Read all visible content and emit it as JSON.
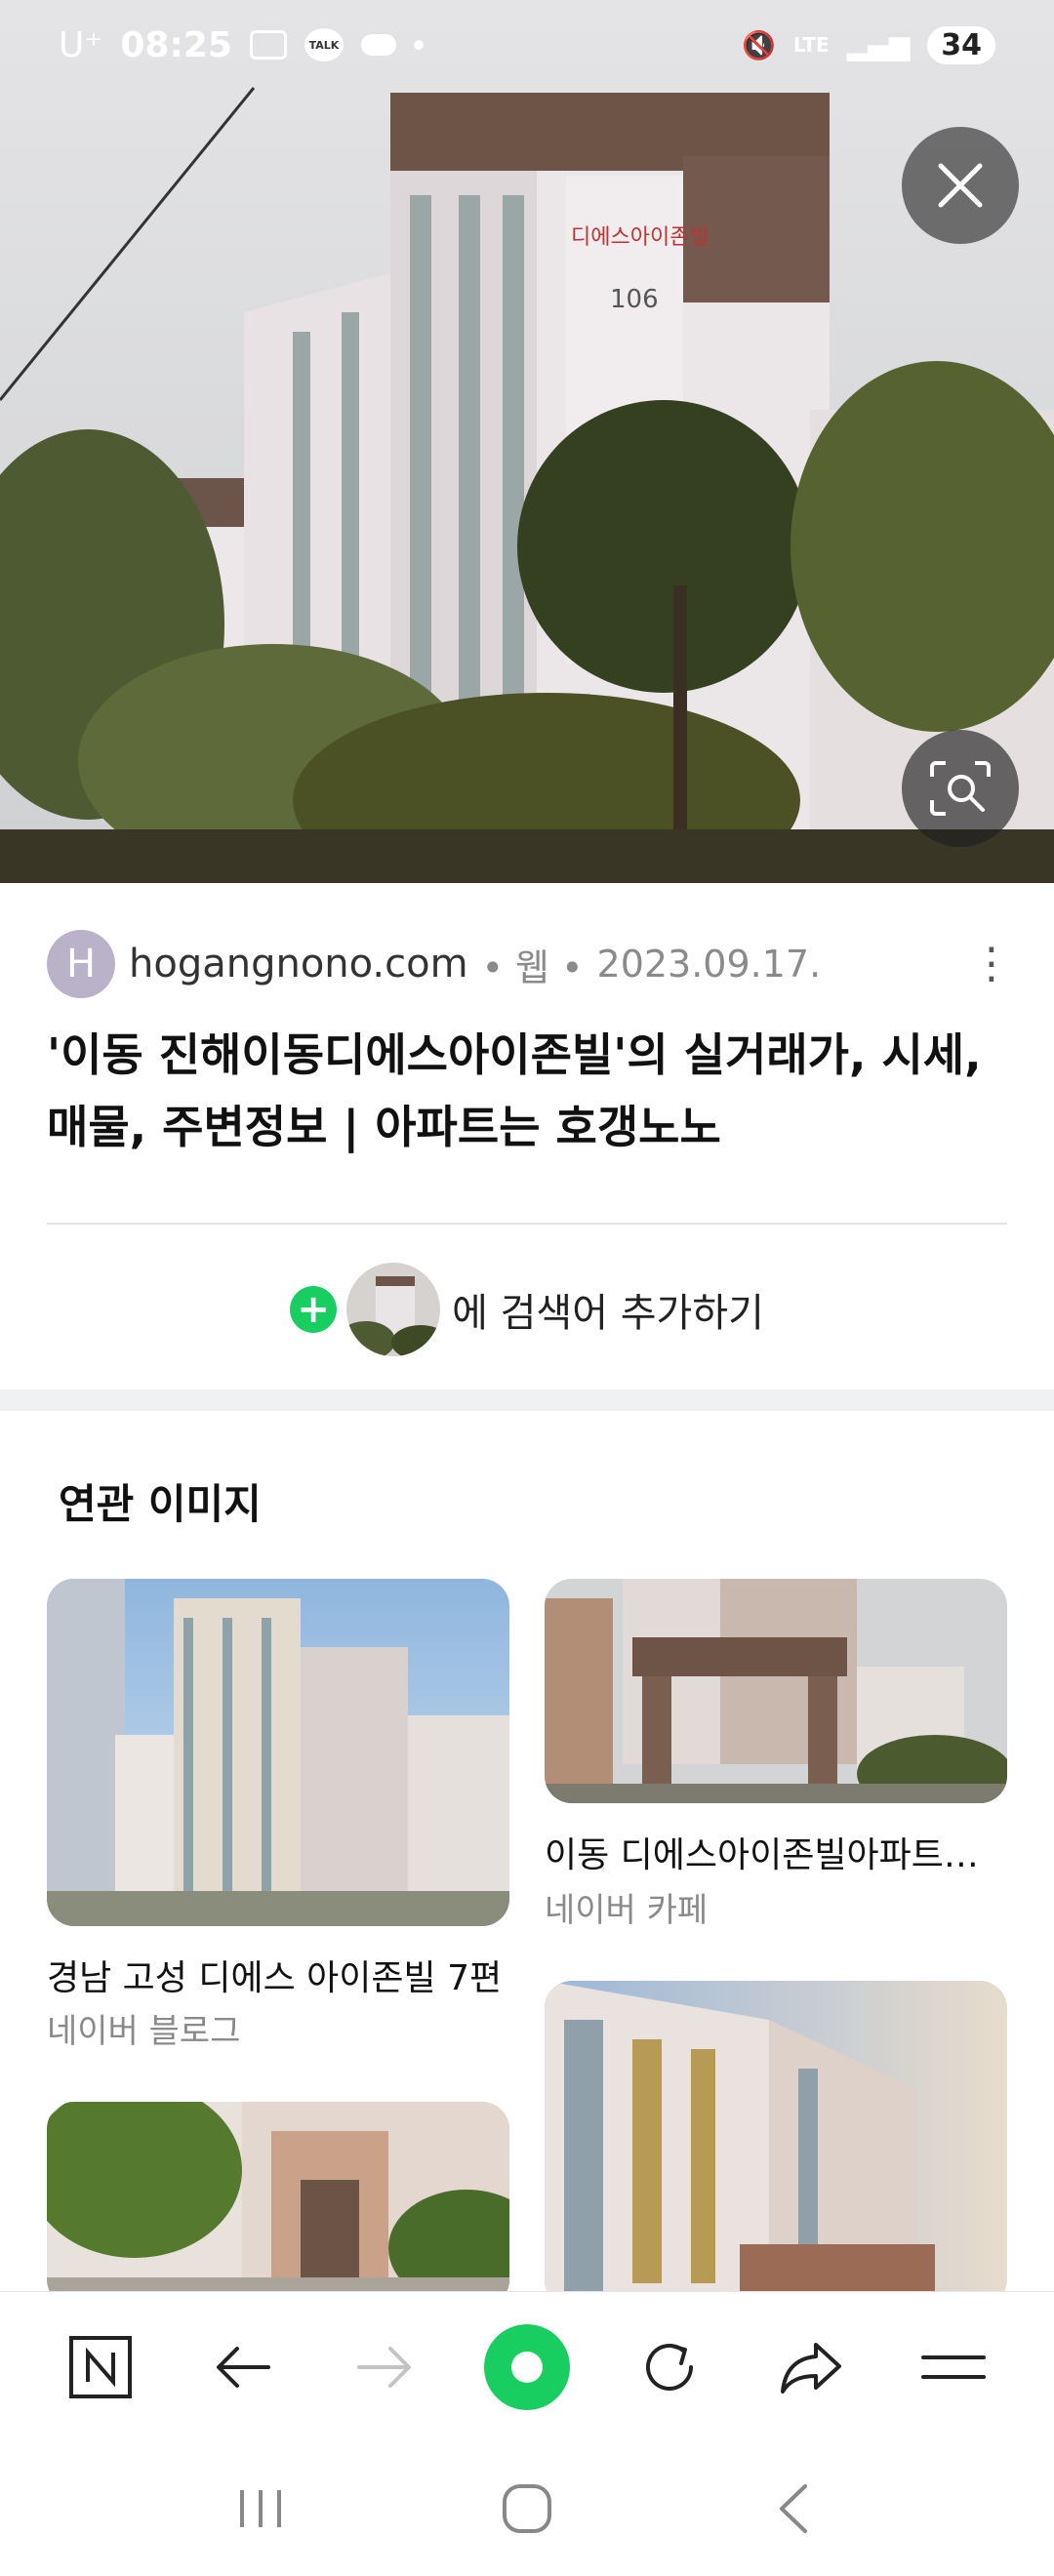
{
  "status": {
    "carrier": "U⁺",
    "time": "08:25",
    "talk_label": "TALK",
    "network": "LTE",
    "battery": "34"
  },
  "hero": {
    "close_icon": "close-icon",
    "lens_icon": "image-search-icon"
  },
  "result": {
    "favicon_letter": "H",
    "domain": "hogangnono.com",
    "type": "• 웹 •",
    "date": "2023.09.17.",
    "title": "'이동 진해이동디에스아이존빌'의 실거래가, 시세, 매물, 주변정보 | 아파트는 호갱노노",
    "more_icon": "⋮"
  },
  "add_search": {
    "label": "에 검색어 추가하기"
  },
  "related": {
    "title": "연관 이미지",
    "items": [
      {
        "caption": "경남 고성 디에스 아이존빌 7편",
        "source": "네이버 블로그"
      },
      {
        "caption": "이동 디에스아이존빌아파트<<...",
        "source": "네이버 카페"
      },
      {
        "caption": "",
        "source": ""
      },
      {
        "caption": "",
        "source": ""
      }
    ]
  },
  "colors": {
    "accent_green": "#19ce60",
    "favicon_bg": "#b9b2c8"
  }
}
